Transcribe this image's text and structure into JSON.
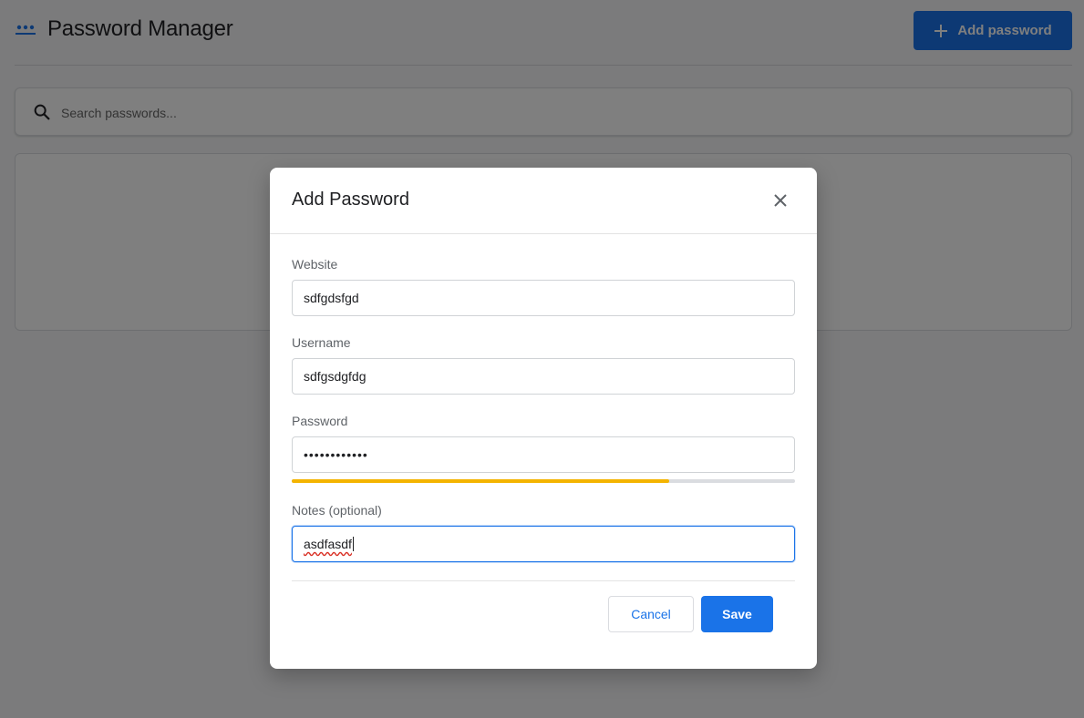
{
  "app": {
    "title": "Password Manager",
    "add_button_label": "Add password",
    "accent_color": "#1a73e8"
  },
  "search": {
    "placeholder": "Search passwords..."
  },
  "modal": {
    "title": "Add Password",
    "fields": {
      "website": {
        "label": "Website",
        "value": "sdfgdsfgd"
      },
      "username": {
        "label": "Username",
        "value": "sdfgsdgfdg"
      },
      "password": {
        "label": "Password",
        "masked_value": "••••••••••••",
        "strength_fraction": 0.75,
        "strength_color": "#f4b400"
      },
      "notes": {
        "label": "Notes (optional)",
        "value": "asdfasdf"
      }
    },
    "cancel_label": "Cancel",
    "save_label": "Save"
  },
  "icons": {
    "logo": "dots-password-icon",
    "add": "plus-icon",
    "search": "search-icon",
    "close": "close-icon"
  }
}
